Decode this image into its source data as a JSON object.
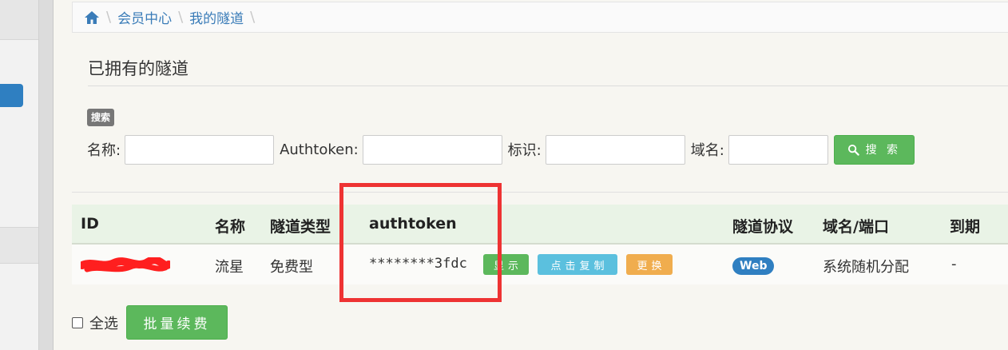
{
  "breadcrumb": {
    "home_icon": "home-icon",
    "items": [
      "会员中心",
      "我的隧道"
    ]
  },
  "page": {
    "title": "已拥有的隧道"
  },
  "search": {
    "badge": "搜索",
    "name_label": "名称:",
    "authtoken_label": "Authtoken:",
    "ident_label": "标识:",
    "domain_label": "域名:",
    "name_value": "",
    "authtoken_value": "",
    "ident_value": "",
    "domain_value": "",
    "button_label": "搜 索",
    "button_icon": "search-icon"
  },
  "table": {
    "headers": [
      "ID",
      "名称",
      "隧道类型",
      "authtoken",
      "隧道协议",
      "域名/端口",
      "到期"
    ],
    "rows": [
      {
        "name": "流星",
        "type": "免费型",
        "authtoken": "********3fdc",
        "show_label": "显示",
        "copy_label": "点击复制",
        "change_label": "更换",
        "protocol": "Web",
        "domain_port": "系统随机分配",
        "expire": "-"
      }
    ]
  },
  "footer": {
    "select_all": "全选",
    "batch_renew": "批量续费"
  },
  "colors": {
    "link": "#3a7cb8",
    "success": "#5cb85c",
    "info": "#5bc0de",
    "warning": "#f0ad4e",
    "primary": "#2f7fc1",
    "highlight": "#ee3333",
    "header_bg": "#e9f3e6"
  }
}
